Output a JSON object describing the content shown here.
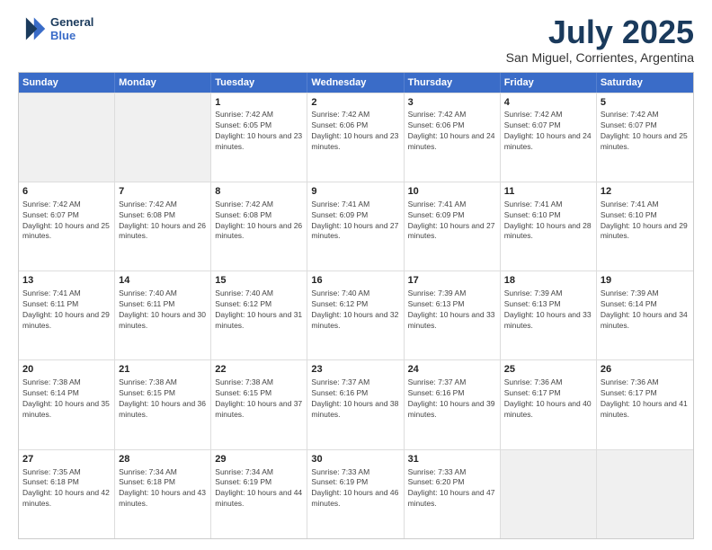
{
  "logo": {
    "line1": "General",
    "line2": "Blue"
  },
  "title": "July 2025",
  "subtitle": "San Miguel, Corrientes, Argentina",
  "header_days": [
    "Sunday",
    "Monday",
    "Tuesday",
    "Wednesday",
    "Thursday",
    "Friday",
    "Saturday"
  ],
  "rows": [
    [
      {
        "day": "",
        "info": "",
        "shaded": true
      },
      {
        "day": "",
        "info": "",
        "shaded": true
      },
      {
        "day": "1",
        "info": "Sunrise: 7:42 AM\nSunset: 6:05 PM\nDaylight: 10 hours and 23 minutes."
      },
      {
        "day": "2",
        "info": "Sunrise: 7:42 AM\nSunset: 6:06 PM\nDaylight: 10 hours and 23 minutes."
      },
      {
        "day": "3",
        "info": "Sunrise: 7:42 AM\nSunset: 6:06 PM\nDaylight: 10 hours and 24 minutes."
      },
      {
        "day": "4",
        "info": "Sunrise: 7:42 AM\nSunset: 6:07 PM\nDaylight: 10 hours and 24 minutes."
      },
      {
        "day": "5",
        "info": "Sunrise: 7:42 AM\nSunset: 6:07 PM\nDaylight: 10 hours and 25 minutes."
      }
    ],
    [
      {
        "day": "6",
        "info": "Sunrise: 7:42 AM\nSunset: 6:07 PM\nDaylight: 10 hours and 25 minutes."
      },
      {
        "day": "7",
        "info": "Sunrise: 7:42 AM\nSunset: 6:08 PM\nDaylight: 10 hours and 26 minutes."
      },
      {
        "day": "8",
        "info": "Sunrise: 7:42 AM\nSunset: 6:08 PM\nDaylight: 10 hours and 26 minutes."
      },
      {
        "day": "9",
        "info": "Sunrise: 7:41 AM\nSunset: 6:09 PM\nDaylight: 10 hours and 27 minutes."
      },
      {
        "day": "10",
        "info": "Sunrise: 7:41 AM\nSunset: 6:09 PM\nDaylight: 10 hours and 27 minutes."
      },
      {
        "day": "11",
        "info": "Sunrise: 7:41 AM\nSunset: 6:10 PM\nDaylight: 10 hours and 28 minutes."
      },
      {
        "day": "12",
        "info": "Sunrise: 7:41 AM\nSunset: 6:10 PM\nDaylight: 10 hours and 29 minutes."
      }
    ],
    [
      {
        "day": "13",
        "info": "Sunrise: 7:41 AM\nSunset: 6:11 PM\nDaylight: 10 hours and 29 minutes."
      },
      {
        "day": "14",
        "info": "Sunrise: 7:40 AM\nSunset: 6:11 PM\nDaylight: 10 hours and 30 minutes."
      },
      {
        "day": "15",
        "info": "Sunrise: 7:40 AM\nSunset: 6:12 PM\nDaylight: 10 hours and 31 minutes."
      },
      {
        "day": "16",
        "info": "Sunrise: 7:40 AM\nSunset: 6:12 PM\nDaylight: 10 hours and 32 minutes."
      },
      {
        "day": "17",
        "info": "Sunrise: 7:39 AM\nSunset: 6:13 PM\nDaylight: 10 hours and 33 minutes."
      },
      {
        "day": "18",
        "info": "Sunrise: 7:39 AM\nSunset: 6:13 PM\nDaylight: 10 hours and 33 minutes."
      },
      {
        "day": "19",
        "info": "Sunrise: 7:39 AM\nSunset: 6:14 PM\nDaylight: 10 hours and 34 minutes."
      }
    ],
    [
      {
        "day": "20",
        "info": "Sunrise: 7:38 AM\nSunset: 6:14 PM\nDaylight: 10 hours and 35 minutes."
      },
      {
        "day": "21",
        "info": "Sunrise: 7:38 AM\nSunset: 6:15 PM\nDaylight: 10 hours and 36 minutes."
      },
      {
        "day": "22",
        "info": "Sunrise: 7:38 AM\nSunset: 6:15 PM\nDaylight: 10 hours and 37 minutes."
      },
      {
        "day": "23",
        "info": "Sunrise: 7:37 AM\nSunset: 6:16 PM\nDaylight: 10 hours and 38 minutes."
      },
      {
        "day": "24",
        "info": "Sunrise: 7:37 AM\nSunset: 6:16 PM\nDaylight: 10 hours and 39 minutes."
      },
      {
        "day": "25",
        "info": "Sunrise: 7:36 AM\nSunset: 6:17 PM\nDaylight: 10 hours and 40 minutes."
      },
      {
        "day": "26",
        "info": "Sunrise: 7:36 AM\nSunset: 6:17 PM\nDaylight: 10 hours and 41 minutes."
      }
    ],
    [
      {
        "day": "27",
        "info": "Sunrise: 7:35 AM\nSunset: 6:18 PM\nDaylight: 10 hours and 42 minutes."
      },
      {
        "day": "28",
        "info": "Sunrise: 7:34 AM\nSunset: 6:18 PM\nDaylight: 10 hours and 43 minutes."
      },
      {
        "day": "29",
        "info": "Sunrise: 7:34 AM\nSunset: 6:19 PM\nDaylight: 10 hours and 44 minutes."
      },
      {
        "day": "30",
        "info": "Sunrise: 7:33 AM\nSunset: 6:19 PM\nDaylight: 10 hours and 46 minutes."
      },
      {
        "day": "31",
        "info": "Sunrise: 7:33 AM\nSunset: 6:20 PM\nDaylight: 10 hours and 47 minutes."
      },
      {
        "day": "",
        "info": "",
        "shaded": true
      },
      {
        "day": "",
        "info": "",
        "shaded": true
      }
    ]
  ]
}
